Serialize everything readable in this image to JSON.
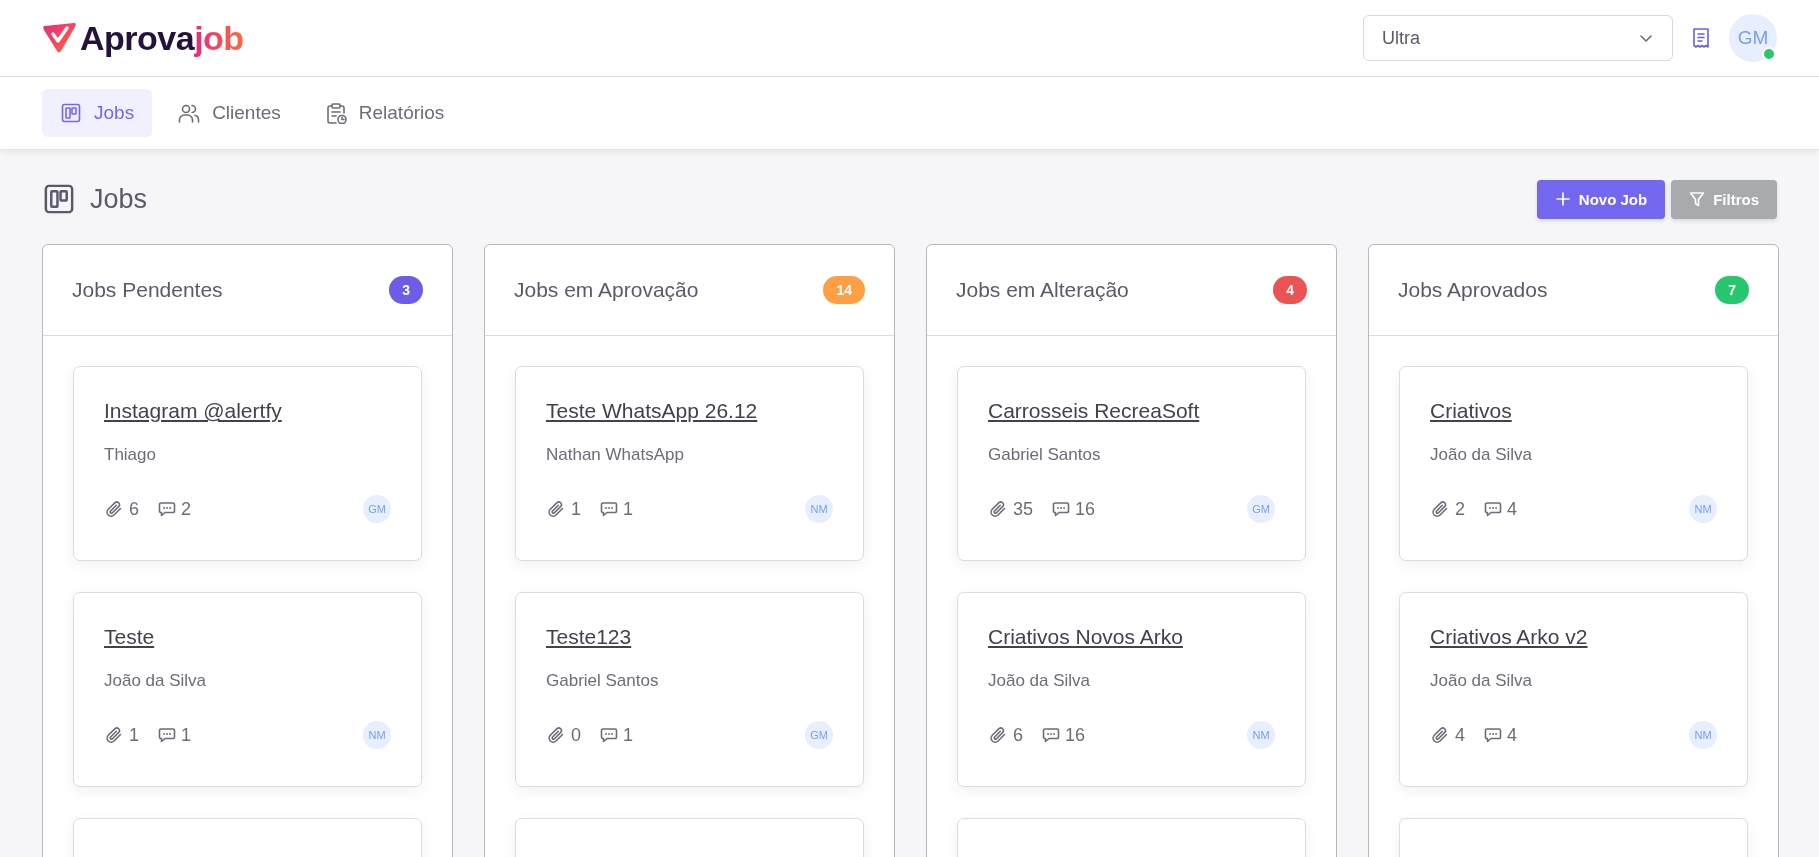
{
  "header": {
    "logo": {
      "main": "Aprova",
      "accent": "job"
    },
    "plan_select": {
      "value": "Ultra"
    },
    "avatar": {
      "initials": "GM",
      "online": true
    }
  },
  "nav": {
    "tabs": [
      {
        "label": "Jobs",
        "selected": true
      },
      {
        "label": "Clientes",
        "selected": false
      },
      {
        "label": "Relatórios",
        "selected": false
      }
    ]
  },
  "page": {
    "title": "Jobs",
    "actions": [
      {
        "label": "Novo Job",
        "kind": "primary"
      },
      {
        "label": "Filtros",
        "kind": "secondary"
      }
    ]
  },
  "columns": [
    {
      "title": "Jobs Pendentes",
      "count": "3",
      "color": "#6c5ce7",
      "more_below": true,
      "cards": [
        {
          "title": "Instagram @alertfy",
          "client": "Thiago",
          "attachments": "6",
          "comments": "2",
          "assignee": "GM"
        },
        {
          "title": "Teste",
          "client": "João da Silva",
          "attachments": "1",
          "comments": "1",
          "assignee": "NM"
        }
      ]
    },
    {
      "title": "Jobs em Aprovação",
      "count": "14",
      "color": "#ff9f43",
      "more_below": true,
      "cards": [
        {
          "title": "Teste WhatsApp 26.12",
          "client": "Nathan WhatsApp",
          "attachments": "1",
          "comments": "1",
          "assignee": "NM"
        },
        {
          "title": "Teste123",
          "client": "Gabriel Santos",
          "attachments": "0",
          "comments": "1",
          "assignee": "GM"
        }
      ]
    },
    {
      "title": "Jobs em Alteração",
      "count": "4",
      "color": "#ea5455",
      "more_below": true,
      "cards": [
        {
          "title": "Carrosseis RecreaSoft",
          "client": "Gabriel Santos",
          "attachments": "35",
          "comments": "16",
          "assignee": "GM"
        },
        {
          "title": "Criativos Novos Arko",
          "client": "João da Silva",
          "attachments": "6",
          "comments": "16",
          "assignee": "NM"
        }
      ]
    },
    {
      "title": "Jobs Aprovados",
      "count": "7",
      "color": "#28c76f",
      "more_below": true,
      "cards": [
        {
          "title": "Criativos",
          "client": "João da Silva",
          "attachments": "2",
          "comments": "4",
          "assignee": "NM"
        },
        {
          "title": "Criativos Arko v2",
          "client": "João da Silva",
          "attachments": "4",
          "comments": "4",
          "assignee": "NM"
        }
      ]
    }
  ]
}
